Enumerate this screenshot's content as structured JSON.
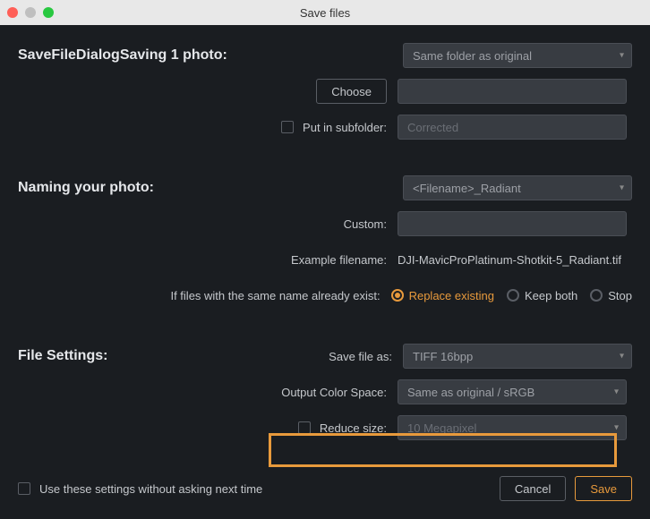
{
  "window": {
    "title": "Save files"
  },
  "saving": {
    "title": "SaveFileDialogSaving 1 photo:",
    "destination_select": "Same folder as original",
    "choose_btn": "Choose",
    "folder_input": "",
    "subfolder_label": "Put in subfolder:",
    "subfolder_placeholder": "Corrected"
  },
  "naming": {
    "title": "Naming your photo:",
    "template_select": "<Filename>_Radiant",
    "custom_label": "Custom:",
    "custom_value": "",
    "example_label": "Example filename:",
    "example_value": "DJI-MavicProPlatinum-Shotkit-5_Radiant.tif",
    "conflict_label": "If files with the same name already exist:",
    "conflict_options": [
      {
        "label": "Replace existing",
        "selected": true
      },
      {
        "label": "Keep both",
        "selected": false
      },
      {
        "label": "Stop",
        "selected": false
      }
    ]
  },
  "file_settings": {
    "title": "File Settings:",
    "save_as_label": "Save file as:",
    "save_as_select": "TIFF 16bpp",
    "colorspace_label": "Output Color Space:",
    "colorspace_select": "Same as original / sRGB",
    "reduce_label": "Reduce size:",
    "reduce_select": "10 Megapixel"
  },
  "footer": {
    "remember_label": "Use these settings without asking next time",
    "cancel": "Cancel",
    "save": "Save"
  }
}
